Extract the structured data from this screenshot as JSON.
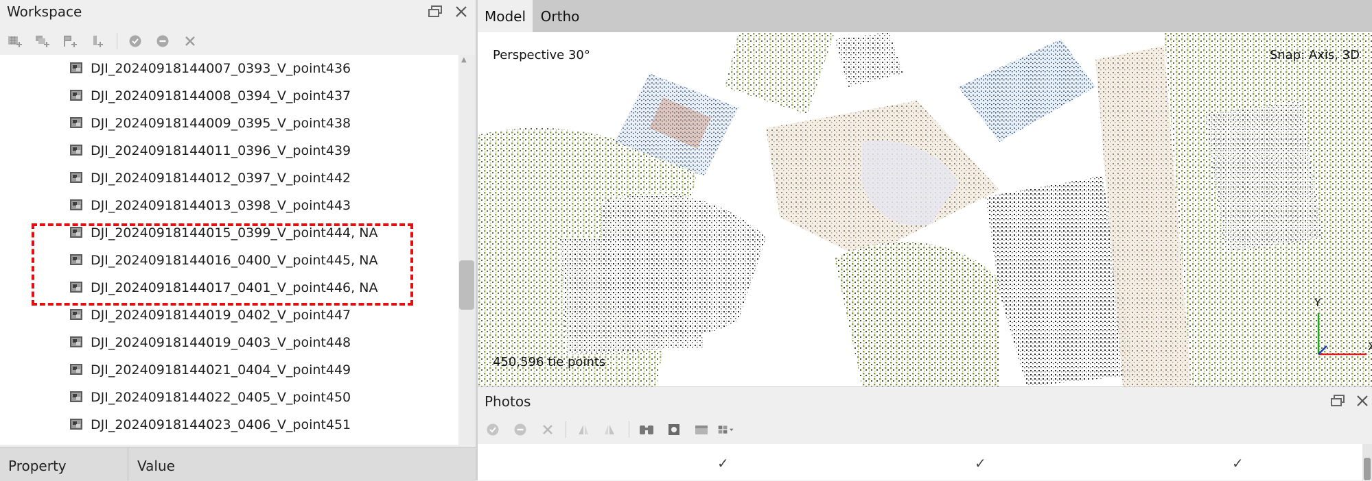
{
  "workspace": {
    "title": "Workspace",
    "toolbar_icons": [
      "add-chunk-icon",
      "add-photos-icon",
      "add-markers-icon",
      "add-scalebar-icon",
      "enable-icon",
      "disable-icon",
      "remove-icon"
    ],
    "items": [
      {
        "label": "DJI_20240918144007_0393_V_point436"
      },
      {
        "label": "DJI_20240918144008_0394_V_point437"
      },
      {
        "label": "DJI_20240918144009_0395_V_point438"
      },
      {
        "label": "DJI_20240918144011_0396_V_point439"
      },
      {
        "label": "DJI_20240918144012_0397_V_point442"
      },
      {
        "label": "DJI_20240918144013_0398_V_point443"
      },
      {
        "label": "DJI_20240918144015_0399_V_point444, NA"
      },
      {
        "label": "DJI_20240918144016_0400_V_point445, NA"
      },
      {
        "label": "DJI_20240918144017_0401_V_point446, NA"
      },
      {
        "label": "DJI_20240918144019_0402_V_point447"
      },
      {
        "label": "DJI_20240918144019_0403_V_point448"
      },
      {
        "label": "DJI_20240918144021_0404_V_point449"
      },
      {
        "label": "DJI_20240918144022_0405_V_point450"
      },
      {
        "label": "DJI_20240918144023_0406_V_point451"
      }
    ]
  },
  "properties": {
    "col_property": "Property",
    "col_value": "Value"
  },
  "view_tabs": {
    "model": "Model",
    "ortho": "Ortho",
    "active": "Model"
  },
  "viewport": {
    "projection": "Perspective 30°",
    "snap": "Snap: Axis, 3D",
    "status": "450,596 tie points",
    "axis_labels": {
      "x": "X",
      "y": "Y"
    },
    "colors": {
      "axis_x": "#d62020",
      "axis_y": "#1fa81f",
      "axis_z": "#2040c0"
    }
  },
  "photos": {
    "title": "Photos",
    "toolbar_icons": [
      "enable-icon",
      "disable-icon",
      "remove-icon",
      "rotate-left-icon",
      "rotate-right-icon",
      "filter-binoculars-icon",
      "mask-icon",
      "view-icon",
      "grid-view-icon"
    ],
    "checks": [
      "✓",
      "✓",
      "✓"
    ]
  },
  "colors": {
    "highlight_border": "#e01010"
  }
}
